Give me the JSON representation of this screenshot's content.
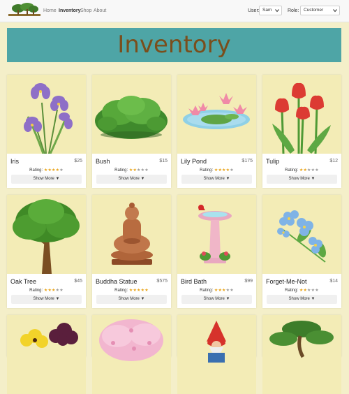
{
  "nav": {
    "links": [
      "Home",
      "Inventory",
      "Shop",
      "About"
    ],
    "user_label": "User:",
    "user_value": "Sam",
    "role_label": "Role:",
    "role_value": "Customer"
  },
  "banner": {
    "title": "Inventory"
  },
  "products": [
    {
      "name": "Iris",
      "price": "$25",
      "rating_label": "Rating:",
      "stars": 4,
      "show_more": "Show More ▼",
      "icon": "iris-flower"
    },
    {
      "name": "Bush",
      "price": "$15",
      "rating_label": "Rating:",
      "stars": 2,
      "show_more": "Show More ▼",
      "icon": "green-bush"
    },
    {
      "name": "Lily Pond",
      "price": "$175",
      "rating_label": "Rating:",
      "stars": 4,
      "show_more": "Show More ▼",
      "icon": "lily-pond"
    },
    {
      "name": "Tulip",
      "price": "$12",
      "rating_label": "Rating:",
      "stars": 2,
      "show_more": "Show More ▼",
      "icon": "red-tulips"
    },
    {
      "name": "Oak Tree",
      "price": "$45",
      "rating_label": "Rating:",
      "stars": 3,
      "show_more": "Show More ▼",
      "icon": "oak-tree"
    },
    {
      "name": "Buddha Statue",
      "price": "$575",
      "rating_label": "Rating:",
      "stars": 5,
      "show_more": "Show More ▼",
      "icon": "buddha-statue"
    },
    {
      "name": "Bird Bath",
      "price": "$99",
      "rating_label": "Rating:",
      "stars": 3,
      "show_more": "Show More ▼",
      "icon": "bird-bath"
    },
    {
      "name": "Forget-Me-Not",
      "price": "$14",
      "rating_label": "Rating:",
      "stars": 2,
      "show_more": "Show More ▼",
      "icon": "forget-me-not"
    }
  ],
  "partial_products": [
    {
      "icon": "pansy-flowers"
    },
    {
      "icon": "cherry-blossom"
    },
    {
      "icon": "garden-gnome"
    },
    {
      "icon": "bonsai-tree"
    }
  ],
  "colors": {
    "page_bg": "#f4efc9",
    "banner_bg": "#4ea5a6",
    "banner_text": "#7a4e1c",
    "card_image_bg": "#f3ecb6",
    "star_active": "#e8a317"
  }
}
